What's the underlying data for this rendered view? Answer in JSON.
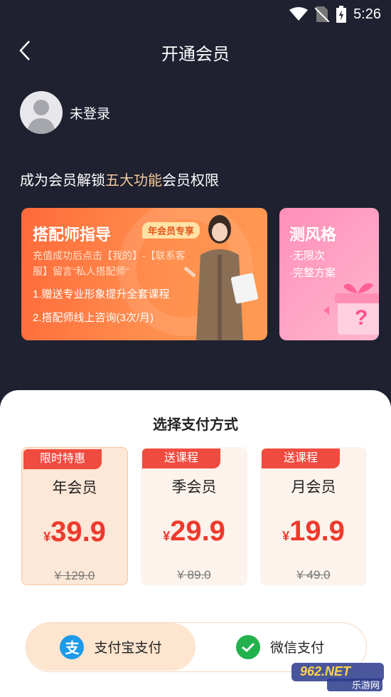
{
  "status_bar": {
    "time": "5:26"
  },
  "header": {
    "title": "开通会员"
  },
  "user": {
    "name": "未登录"
  },
  "unlock": {
    "prefix": "成为会员解锁",
    "highlight": "五大功能",
    "suffix": "会员权限"
  },
  "feature_cards": [
    {
      "title": "搭配师指导",
      "badge": "年会员专享",
      "desc": "充值成功后点击【我的】-【联系客服】留言“私人搭配师”",
      "items": [
        "1.赠送专业形象提升全套课程",
        "2.搭配师线上咨询(3次/月)"
      ]
    },
    {
      "title": "测风格",
      "items": [
        "·无限次",
        "·完整方案"
      ]
    }
  ],
  "sheet": {
    "title": "选择支付方式"
  },
  "plans": [
    {
      "tag": "限时特惠",
      "name": "年会员",
      "currency": "¥",
      "price": "39.9",
      "original": "¥ 129.0",
      "selected": true
    },
    {
      "tag": "送课程",
      "name": "季会员",
      "currency": "¥",
      "price": "29.9",
      "original": "¥ 89.0",
      "selected": false
    },
    {
      "tag": "送课程",
      "name": "月会员",
      "currency": "¥",
      "price": "19.9",
      "original": "¥ 49.0",
      "selected": false
    }
  ],
  "payment": {
    "alipay_label": "支付宝支付",
    "wechat_label": "微信支付",
    "selected": "alipay"
  },
  "watermark": {
    "text": "962.NET",
    "sub": "乐游网"
  },
  "colors": {
    "background": "#1f2130",
    "accent_red": "#ee3a2c",
    "highlight_gold": "#f2c899"
  }
}
